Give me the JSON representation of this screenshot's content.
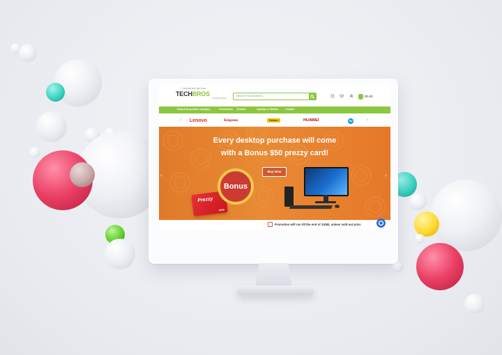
{
  "site": {
    "logo_top": "YOUR ONE STOP TECH SHOP",
    "logo_main": "TECH",
    "logo_accent": "BROS",
    "logo_sub": "TECHSOLUTIONS"
  },
  "search": {
    "placeholder": "Search for products..."
  },
  "header": {
    "cart_price": "R0.00"
  },
  "nav": {
    "items": [
      "Search by product category",
      "Promotions",
      "Brands",
      "Laptops & Tablets",
      "Contact"
    ]
  },
  "brands": [
    "Lenovo",
    "Kingston",
    "Sahara",
    "HUAWEI",
    "hp"
  ],
  "banner": {
    "line1": "Every desktop purchase will come",
    "line2": "with a Bonus $50 prezzy card!",
    "buy_label": "Buy Now",
    "bonus_label": "Bonus",
    "card_brand": "Prezzy",
    "card_network": "VISA"
  },
  "promo": {
    "text": "Promotion will run till the end of JUNE, unless sold out prior."
  },
  "colors": {
    "brand_green": "#8dc63f",
    "banner_orange": "#e98a34",
    "bonus_red": "#cc3b32"
  }
}
